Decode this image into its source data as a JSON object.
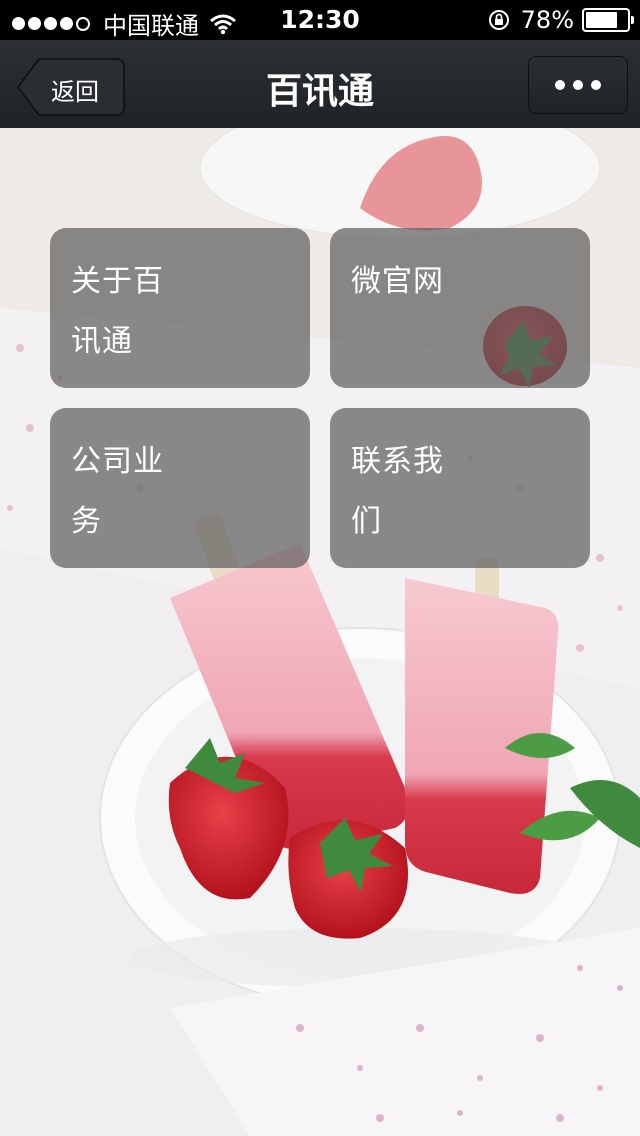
{
  "status_bar": {
    "carrier": "中国联通",
    "time": "12:30",
    "battery": "78%",
    "battery_level": 0.78,
    "signal_bars": 4,
    "signal_max": 5
  },
  "nav": {
    "back_label": "返回",
    "title": "百讯通",
    "more_icon": "ellipsis-icon"
  },
  "tiles": [
    {
      "label": "关于百讯通"
    },
    {
      "label": "微官网"
    },
    {
      "label": "公司业务"
    },
    {
      "label": "联系我们"
    }
  ],
  "colors": {
    "nav_bg": "#25292c",
    "tile_bg": "rgba(95,95,95,0.72)"
  }
}
